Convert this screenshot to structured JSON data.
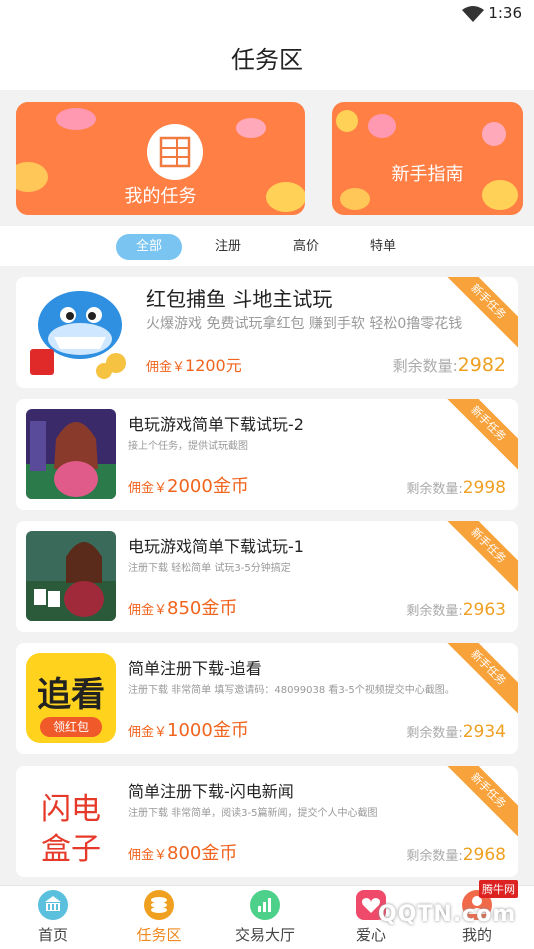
{
  "status": {
    "time": "1:36"
  },
  "header": {
    "title": "任务区"
  },
  "banners": [
    {
      "label": "我的任务"
    },
    {
      "label": "新手指南"
    }
  ],
  "filters": [
    {
      "label": "全部",
      "active": true
    },
    {
      "label": "注册",
      "active": false
    },
    {
      "label": "高价",
      "active": false
    },
    {
      "label": "特单",
      "active": false
    }
  ],
  "tasks": [
    {
      "title": "红包捕鱼  斗地主试玩",
      "desc": "火爆游戏 免费试玩拿红包 赚到手软 轻松0撸零花钱",
      "reward_label": "佣金￥",
      "reward": "1200元",
      "remain_label": "剩余数量:",
      "remain": "2982",
      "badge": "新手任务"
    },
    {
      "title": "电玩游戏简单下载试玩-2",
      "desc": "接上个任务，提供试玩截图",
      "reward_label": "佣金￥",
      "reward": "2000金币",
      "remain_label": "剩余数量:",
      "remain": "2998",
      "badge": "新手任务"
    },
    {
      "title": "电玩游戏简单下载试玩-1",
      "desc": "注册下载 轻松简单 试玩3-5分钟搞定",
      "reward_label": "佣金￥",
      "reward": "850金币",
      "remain_label": "剩余数量:",
      "remain": "2963",
      "badge": "新手任务"
    },
    {
      "title": "简单注册下载-追看",
      "desc": "注册下载 非常简单 填写邀请码：48099038 看3-5个视频提交中心截图。",
      "reward_label": "佣金￥",
      "reward": "1000金币",
      "remain_label": "剩余数量:",
      "remain": "2934",
      "badge": "新手任务",
      "thumb_text_1": "追看",
      "thumb_text_2": "领红包"
    },
    {
      "title": "简单注册下载-闪电新闻",
      "desc": "注册下载 非常简单，阅读3-5篇新闻，提交个人中心截图",
      "reward_label": "佣金￥",
      "reward": "800金币",
      "remain_label": "剩余数量:",
      "remain": "2968",
      "badge": "新手任务",
      "thumb_text_1": "闪电",
      "thumb_text_2": "盒子"
    }
  ],
  "tabs": [
    {
      "label": "首页",
      "icon": "bank-icon",
      "color": "#5bc0de"
    },
    {
      "label": "任务区",
      "icon": "coins-icon",
      "color": "#f0a021"
    },
    {
      "label": "交易大厅",
      "icon": "chart-icon",
      "color": "#4cd08a"
    },
    {
      "label": "爱心",
      "icon": "heart-icon",
      "color": "#f04a6a"
    },
    {
      "label": "我的",
      "icon": "user-icon",
      "color": "#f06a4a"
    }
  ],
  "watermark": {
    "text": "QQTN.com",
    "sub": "腾牛网"
  },
  "colors": {
    "accent": "#f0641e",
    "banner": "#ff7f45",
    "filter_active": "#7ac4f2",
    "remain": "#f0a021",
    "badge": "#f7a23b"
  }
}
